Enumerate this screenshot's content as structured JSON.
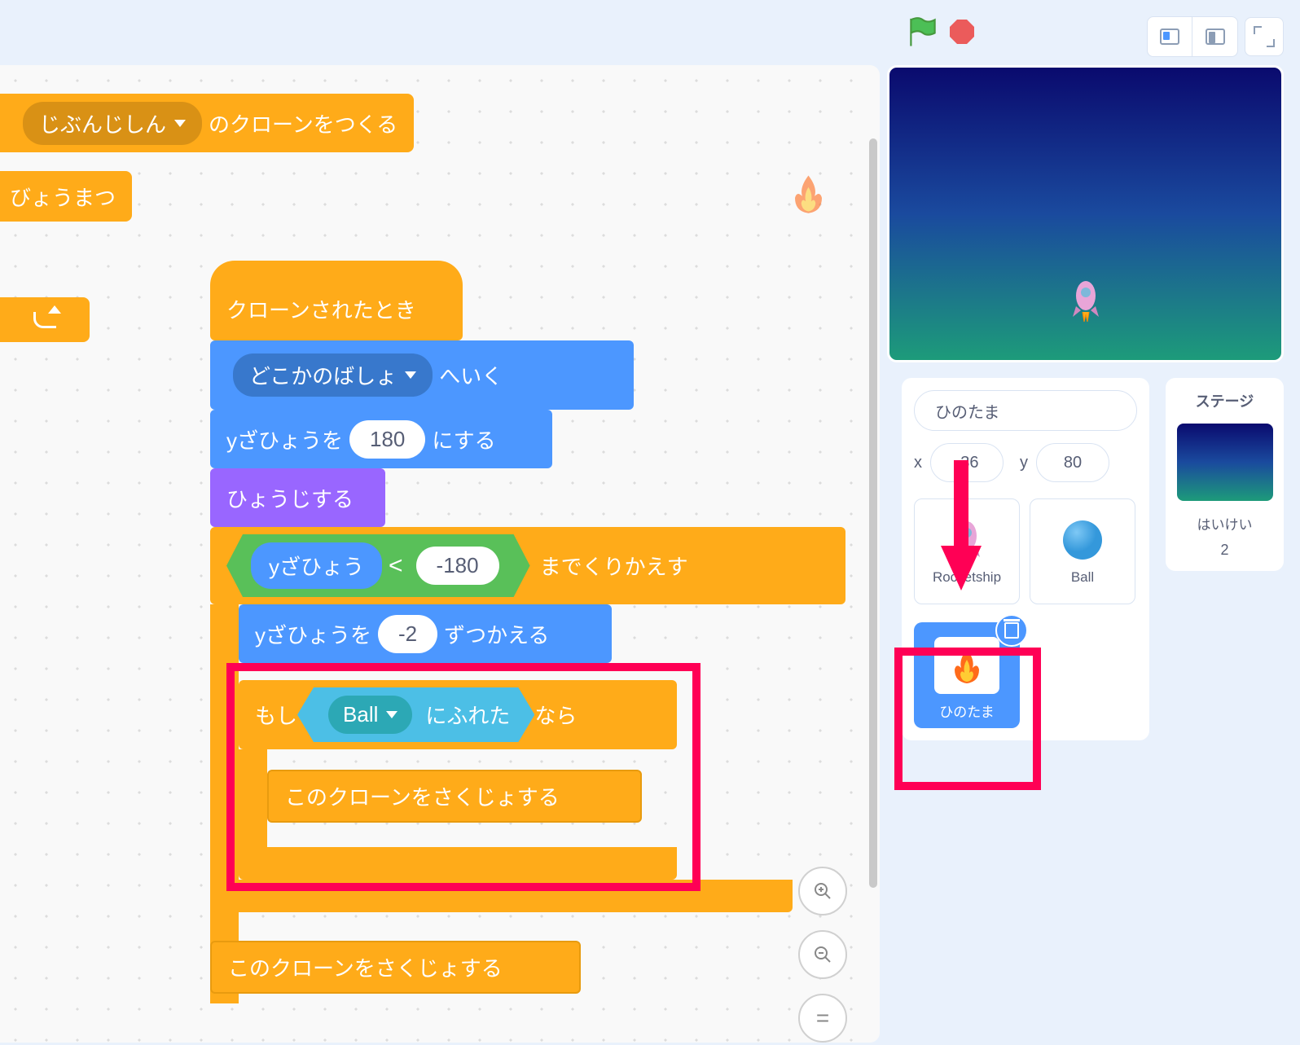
{
  "controls": {
    "flag": "green-flag",
    "stop": "stop"
  },
  "stage_panel": {
    "title": "ステージ",
    "backdrop_label": "はいけい",
    "backdrop_count": "2"
  },
  "sprite_panel": {
    "name": "ひのたま",
    "x_label": "x",
    "x_value": "-36",
    "y_label": "y",
    "y_value": "80",
    "sprites": [
      {
        "name": "Rocketship",
        "icon": "rocket"
      },
      {
        "name": "Ball",
        "icon": "ball"
      },
      {
        "name": "ひのたま",
        "icon": "fire",
        "selected": true
      }
    ]
  },
  "blocks": {
    "create_clone_prefix": "じぶんじしん",
    "create_clone_suffix": "のクローンをつくる",
    "spawn": "びょうまつ",
    "hat": "クローンされたとき",
    "goto_prefix": "どこかのばしょ",
    "goto_suffix": "へいく",
    "set_y_prefix": "yざひょうを",
    "set_y_value": "180",
    "set_y_suffix": "にする",
    "show": "ひょうじする",
    "repeat_until_suffix": "までくりかえす",
    "y_position": "yざひょう",
    "lt": "<",
    "neg_180": "-180",
    "change_y_prefix": "yざひょうを",
    "change_y_value": "-2",
    "change_y_suffix": "ずつかえる",
    "if_prefix": "もし",
    "touching_target": "Ball",
    "touching_suffix": "にふれた",
    "if_suffix": "なら",
    "delete_clone": "このクローンをさくじょする",
    "delete_clone_2": "このクローンをさくじょする"
  }
}
